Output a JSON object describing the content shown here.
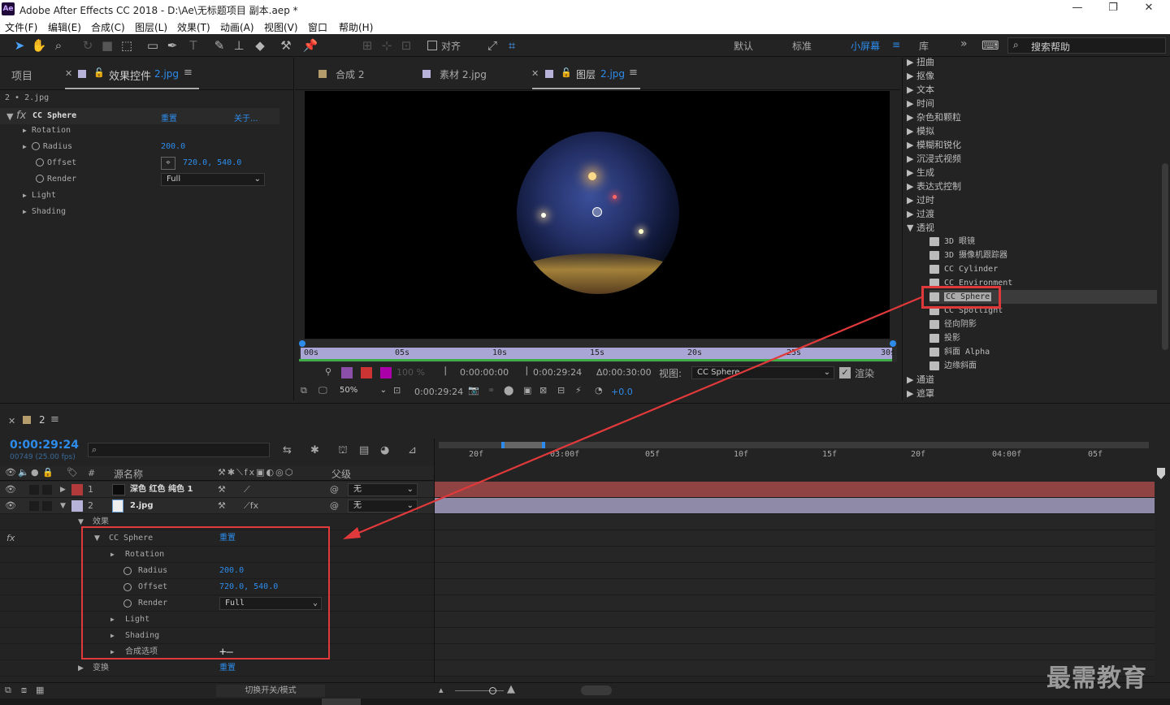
{
  "window": {
    "title": "Adobe After Effects CC 2018 - D:\\Ae\\无标题项目 副本.aep *",
    "logo": "Ae"
  },
  "menu": [
    "文件(F)",
    "编辑(E)",
    "合成(C)",
    "图层(L)",
    "效果(T)",
    "动画(A)",
    "视图(V)",
    "窗口",
    "帮助(H)"
  ],
  "toolbar": {
    "snap_label": "对齐",
    "workspaces": [
      "默认",
      "标准",
      "小屏幕",
      "库"
    ],
    "active_workspace": "小屏幕",
    "search_placeholder": "搜索帮助"
  },
  "left_panel": {
    "tab_project": "项目",
    "tab_effect": "效果控件",
    "tab_effect_layer": "2.jpg",
    "layer_path": "2 • 2.jpg",
    "effect": {
      "fx": "fx",
      "name": "CC Sphere",
      "reset": "重置",
      "about": "关于...",
      "props": [
        {
          "name": "Rotation",
          "value": ""
        },
        {
          "name": "Radius",
          "value": "200.0"
        },
        {
          "name": "Offset",
          "value": "720.0, 540.0"
        },
        {
          "name": "Render",
          "value": "Full"
        },
        {
          "name": "Light",
          "value": ""
        },
        {
          "name": "Shading",
          "value": ""
        }
      ]
    }
  },
  "viewer_tabs": [
    {
      "label": "合成 2",
      "hl": ""
    },
    {
      "label": "素材 2.jpg",
      "hl": ""
    },
    {
      "label": "图层",
      "hl": "2.jpg"
    }
  ],
  "viewer": {
    "ruler": [
      "00s",
      "05s",
      "10s",
      "15s",
      "20s",
      "25s",
      "30s"
    ],
    "opacity": "100 %",
    "time_in": "0:00:00:00",
    "time_out": "0:00:29:24",
    "duration": "Δ0:00:30:00",
    "view_label": "视图:",
    "view_value": "CC Sphere",
    "render_label": "渲染",
    "zoom": "50%",
    "current_time": "0:00:29:24",
    "exposure": "+0.0"
  },
  "effects_panel": {
    "categories": [
      "扭曲",
      "抠像",
      "文本",
      "时间",
      "杂色和颗粒",
      "模拟",
      "模糊和锐化",
      "沉浸式视频",
      "生成",
      "表达式控制",
      "过时",
      "过渡"
    ],
    "open_category": "透视",
    "items": [
      "3D 眼镜",
      "3D 摄像机跟踪器",
      "CC Cylinder",
      "CC Environment",
      "CC Sphere",
      "CC Spotlight",
      "径向阴影",
      "投影",
      "斜面 Alpha",
      "边缘斜面"
    ],
    "selected_item": "CC Sphere",
    "after": [
      "通道",
      "遮罩"
    ]
  },
  "timeline": {
    "comp_name": "2",
    "time": "0:00:29:24",
    "fps": "00749 (25.00 fps)",
    "col_num": "#",
    "col_source": "源名称",
    "col_parent": "父级",
    "ruler": [
      "20f",
      "03:00f",
      "05f",
      "10f",
      "15f",
      "20f",
      "04:00f",
      "05f"
    ],
    "layers": [
      {
        "num": "1",
        "name": "深色 红色 纯色 1",
        "color": "#b33a3a",
        "parent": "无"
      },
      {
        "num": "2",
        "name": "2.jpg",
        "color": "#b7b2d8",
        "parent": "无"
      }
    ],
    "effects_group": "效果",
    "effect_name": "CC Sphere",
    "reset": "重置",
    "props": [
      {
        "name": "Rotation",
        "value": ""
      },
      {
        "name": "Radius",
        "value": "200.0"
      },
      {
        "name": "Offset",
        "value": "720.0, 540.0"
      },
      {
        "name": "Render",
        "value": "Full"
      },
      {
        "name": "Light",
        "value": ""
      },
      {
        "name": "Shading",
        "value": ""
      },
      {
        "name": "合成选项",
        "value": "+—"
      }
    ],
    "transform": "变换",
    "transform_reset": "重置",
    "toggle_label": "切换开关/模式"
  },
  "watermark": "最需教育",
  "colors": {
    "accent": "#2d8ceb",
    "highlight": "#e0393b"
  }
}
